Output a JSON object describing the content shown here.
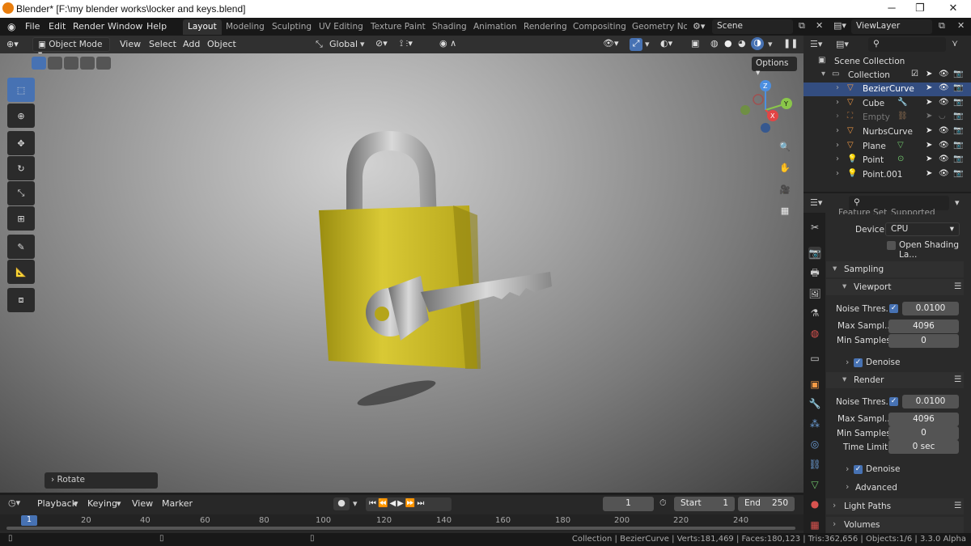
{
  "window": {
    "title": "Blender* [F:\\my blender works\\locker and keys.blend]"
  },
  "menu": {
    "items": [
      "File",
      "Edit",
      "Render",
      "Window",
      "Help"
    ]
  },
  "workspaces": [
    "Layout",
    "Modeling",
    "Sculpting",
    "UV Editing",
    "Texture Paint",
    "Shading",
    "Animation",
    "Rendering",
    "Compositing",
    "Geometry Noc"
  ],
  "scene": "Scene",
  "view_layer": "ViewLayer",
  "viewport_header": {
    "mode": "Object Mode",
    "menus": [
      "View",
      "Select",
      "Add",
      "Object"
    ],
    "transform": "Global",
    "options": "Options"
  },
  "operator_panel": "Rotate",
  "outliner": {
    "root": "Scene Collection",
    "collection": "Collection",
    "objects": [
      "BezierCurve",
      "Cube",
      "Empty",
      "NurbsCurve",
      "Plane",
      "Point",
      "Point.001"
    ]
  },
  "properties": {
    "feature_set_label": "Feature Set",
    "feature_set": "Supported",
    "device_label": "Device",
    "device": "CPU",
    "osl": "Open Shading La...",
    "sampling": "Sampling",
    "viewport": {
      "title": "Viewport",
      "noise_label": "Noise Thres...",
      "noise": "0.0100",
      "max_label": "Max Sampl...",
      "max": "4096",
      "min_label": "Min Samples",
      "min": "0",
      "denoise": "Denoise"
    },
    "render": {
      "title": "Render",
      "noise_label": "Noise Thres...",
      "noise": "0.0100",
      "max_label": "Max Sampl...",
      "max": "4096",
      "min_label": "Min Samples",
      "min": "0",
      "time_label": "Time Limit",
      "time": "0 sec",
      "denoise": "Denoise"
    },
    "advanced": "Advanced",
    "light_paths": "Light Paths",
    "volumes": "Volumes"
  },
  "timeline": {
    "menus": [
      "Playback",
      "Keying",
      "View",
      "Marker"
    ],
    "current_frame": "1",
    "start_label": "Start",
    "start": "1",
    "end_label": "End",
    "end": "250",
    "ticks": [
      "1",
      "20",
      "40",
      "60",
      "80",
      "100",
      "120",
      "140",
      "160",
      "180",
      "200",
      "220",
      "240"
    ]
  },
  "status": "Collection | BezierCurve | Verts:181,469 | Faces:180,123 | Tris:362,656 | Objects:1/6 | 3.3.0 Alpha",
  "colors": {
    "accent": "#4772b3",
    "selected": "#334d80",
    "padlock": "#c8b820",
    "gizmo_x": "#e34545",
    "gizmo_y": "#8ac64a",
    "gizmo_z": "#4c8fe0"
  }
}
